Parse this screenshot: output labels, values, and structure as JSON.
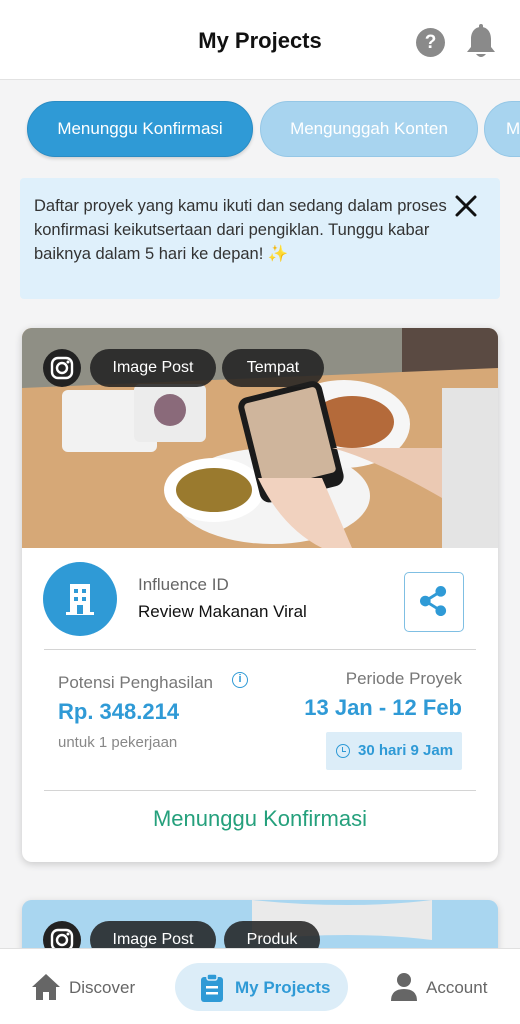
{
  "header": {
    "title": "My Projects",
    "help_icon": "question-circle-icon",
    "notification_icon": "bell-icon"
  },
  "tabs": [
    {
      "label": "Menunggu Konfirmasi",
      "active": true
    },
    {
      "label": "Mengunggah Konten",
      "active": false
    },
    {
      "label": "M",
      "active": false
    }
  ],
  "info_banner": {
    "text": "Daftar proyek yang kamu ikuti dan sedang dalam proses konfirmasi keikutsertaan dari pengiklan. Tunggu kabar baiknya dalam 5 hari ke depan! ✨",
    "close_icon": "close-icon"
  },
  "projects": [
    {
      "platform_icon": "instagram-icon",
      "tags": [
        "Image Post",
        "Tempat"
      ],
      "brand": "Influence ID",
      "name": "Review Makanan Viral",
      "earnings_label": "Potensi Penghasilan",
      "earnings_value": "Rp. 348.214",
      "earnings_note": "untuk 1 pekerjaan",
      "period_label": "Periode Proyek",
      "period_value": "13 Jan - 12 Feb",
      "duration": "30 hari 9 Jam",
      "status": "Menunggu Konfirmasi"
    },
    {
      "platform_icon": "instagram-icon",
      "tags": [
        "Image Post",
        "Produk"
      ]
    }
  ],
  "bottom_nav": [
    {
      "label": "Discover",
      "icon": "home-icon",
      "active": false
    },
    {
      "label": "My Projects",
      "icon": "clipboard-icon",
      "active": true
    },
    {
      "label": "Account",
      "icon": "user-icon",
      "active": false
    }
  ],
  "colors": {
    "accent": "#2f9ad6",
    "accent_light": "#a8d4ef",
    "status_green": "#25a07c",
    "banner_bg": "#dff0fb"
  }
}
